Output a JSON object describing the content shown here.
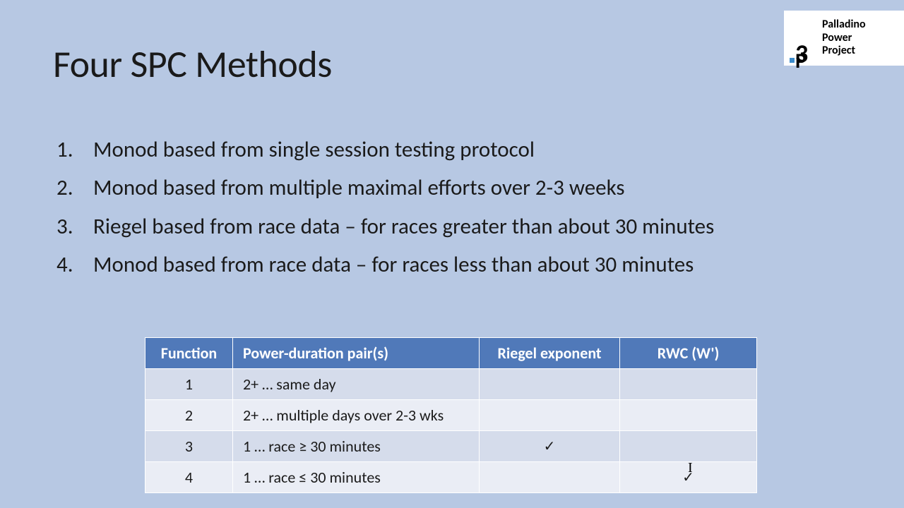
{
  "logo": {
    "line1": "Palladino",
    "line2": "Power",
    "line3": "Project",
    "mark_top": "3",
    "mark_bottom": "P"
  },
  "title": "Four SPC Methods",
  "items": [
    {
      "num": "1.",
      "text": "Monod based from single session testing protocol"
    },
    {
      "num": "2.",
      "text": "Monod based from multiple maximal efforts over 2-3 weeks"
    },
    {
      "num": "3.",
      "text": "Riegel based from race data – for races greater than about 30 minutes"
    },
    {
      "num": "4.",
      "text": "Monod based from race data – for races less than about 30 minutes"
    }
  ],
  "table": {
    "headers": {
      "fn": "Function",
      "pd": "Power-duration pair(s)",
      "re": "Riegel exponent",
      "rwc": "RWC (W')"
    },
    "rows": [
      {
        "fn": "1",
        "pd": "2+ … same day",
        "re": "",
        "rwc": ""
      },
      {
        "fn": "2",
        "pd": "2+ … multiple days over 2-3 wks",
        "re": "",
        "rwc": ""
      },
      {
        "fn": "3",
        "pd": "1 … race ≥ 30 minutes",
        "re": "✓",
        "rwc": ""
      },
      {
        "fn": "4",
        "pd": "1 … race  ≤ 30 minutes",
        "re": "",
        "rwc": "✓"
      }
    ]
  },
  "cursor_glyph": "I"
}
